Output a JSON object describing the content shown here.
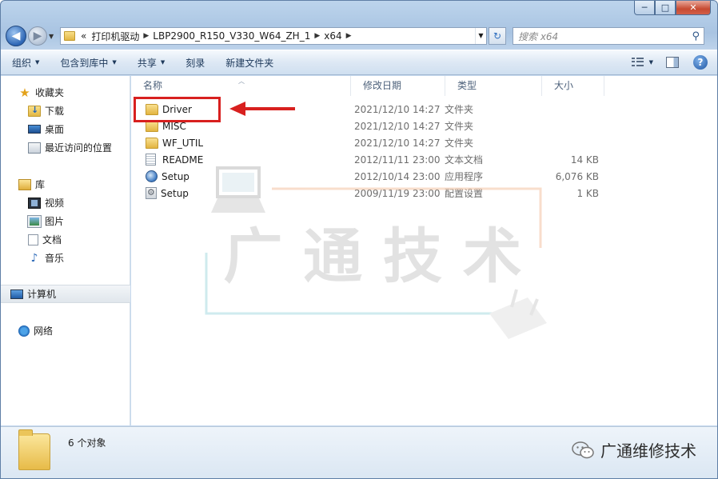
{
  "window": {
    "min_glyph": "─",
    "max_glyph": "□",
    "close_glyph": "✕"
  },
  "address_bar": {
    "back_glyph": "◀",
    "forward_glyph": "▶",
    "overflow": "«",
    "crumbs": [
      "打印机驱动",
      "LBP2900_R150_V330_W64_ZH_1",
      "x64"
    ],
    "refresh_glyph": "↻",
    "search_placeholder": "搜索 x64"
  },
  "toolbar": {
    "organize": "组织",
    "include_in_library": "包含到库中",
    "share": "共享",
    "burn": "刻录",
    "new_folder": "新建文件夹",
    "help": "?"
  },
  "navigation": {
    "favorites": {
      "label": "收藏夹",
      "items": [
        "下载",
        "桌面",
        "最近访问的位置"
      ]
    },
    "libraries": {
      "label": "库",
      "items": [
        "视频",
        "图片",
        "文档",
        "音乐"
      ]
    },
    "computer": "计算机",
    "network": "网络"
  },
  "columns": {
    "name": "名称",
    "date": "修改日期",
    "type": "类型",
    "size": "大小"
  },
  "files": [
    {
      "name": "Driver",
      "date": "2021/12/10 14:27",
      "type": "文件夹",
      "size": "",
      "icon": "folder-icon"
    },
    {
      "name": "MISC",
      "date": "2021/12/10 14:27",
      "type": "文件夹",
      "size": "",
      "icon": "folder-icon"
    },
    {
      "name": "WF_UTIL",
      "date": "2021/12/10 14:27",
      "type": "文件夹",
      "size": "",
      "icon": "folder-icon"
    },
    {
      "name": "README",
      "date": "2012/11/11 23:00",
      "type": "文本文档",
      "size": "14 KB",
      "icon": "text-file-icon"
    },
    {
      "name": "Setup",
      "date": "2012/10/14 23:00",
      "type": "应用程序",
      "size": "6,076 KB",
      "icon": "setup-app-icon"
    },
    {
      "name": "Setup",
      "date": "2009/11/19 23:00",
      "type": "配置设置",
      "size": "1 KB",
      "icon": "config-file-icon"
    }
  ],
  "watermark": {
    "text": "广 通 技 术"
  },
  "details_pane": {
    "count": "6 个对象"
  },
  "branding": {
    "wechat_account": "广通维修技术"
  },
  "colors": {
    "highlight": "#d8201f",
    "watermark_orange": "#f3c3a3",
    "watermark_teal": "#a8dbe1"
  }
}
